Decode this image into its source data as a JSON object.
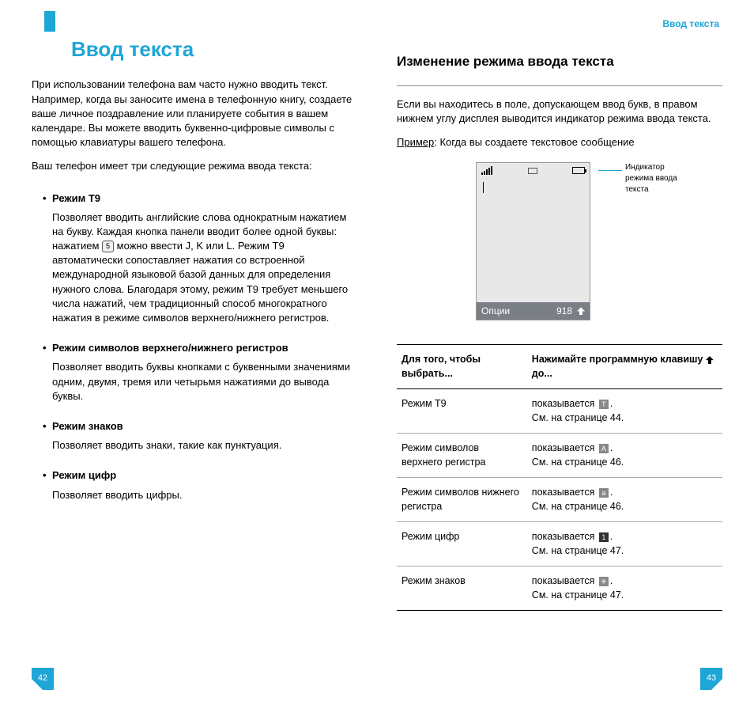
{
  "running_header": "Ввод текста",
  "left": {
    "chapter": "Ввод текста",
    "intro1": "При использовании телефона вам часто нужно вводить текст. Например, когда вы заносите имена в телефонную книгу, создаете ваше личное поздравление или планируете события в вашем календаре. Вы можете вводить буквенно-цифровые символы с помощью клавиатуры вашего телефона.",
    "intro2": "Ваш телефон имеет три следующие режима ввода текста:",
    "modes": [
      {
        "title": "Режим Т9",
        "desc_pre": "Позволяет вводить английские слова однократным нажатием на букву. Каждая кнопка панели вводит более одной буквы: нажатием ",
        "key": "5",
        "desc_post": " можно ввести J, K или L. Режим Т9 автоматически сопоставляет нажатия со встроенной международной языковой базой данных для определения нужного слова. Благодаря этому, режим T9 требует меньшего числа нажатий, чем традиционный способ многократного нажатия в режиме символов верхнего/нижнего регистров."
      },
      {
        "title": "Режим символов верхнего/нижнего регистров",
        "desc": "Позволяет вводить буквы кнопками с буквенными значениями одним, двумя, тремя или четырьмя нажатиями до вывода буквы."
      },
      {
        "title": "Режим знаков",
        "desc": "Позволяет вводить знаки, такие как пунктуация."
      },
      {
        "title": "Режим цифр",
        "desc": "Позволяет вводить цифры."
      }
    ],
    "page_num": "42"
  },
  "right": {
    "section": "Изменение режима ввода текста",
    "intro": "Если вы находитесь в поле, допускающем ввод букв, в правом нижнем углу дисплея выводится индикатор режима ввода текста.",
    "example_label": "Пример",
    "example_text": ": Когда вы создаете текстовое сообщение",
    "phone": {
      "soft_left": "Опции",
      "counter": "918"
    },
    "fig_label": "Индикатор режима ввода текста",
    "table": {
      "head1": "Для того, чтобы выбрать...",
      "head2_pre": "Нажимайте программную клавишу ",
      "head2_post": " до...",
      "rows": [
        {
          "c1": "Режим Т9",
          "show": "показывается ",
          "icon": "T",
          "ref": "См. на странице 44."
        },
        {
          "c1": "Режим символов верхнего регистра",
          "show": "показывается ",
          "icon": "A",
          "ref": "См. на странице 46."
        },
        {
          "c1": "Режим символов нижнего регистра",
          "show": "показывается ",
          "icon": "a",
          "ref": "См. на странице 46."
        },
        {
          "c1": "Режим цифр",
          "show": "показывается ",
          "icon": "1",
          "icon_dark": true,
          "ref": "См. на странице 47."
        },
        {
          "c1": "Режим знаков",
          "show": "показывается ",
          "icon": "✳",
          "ref": "См. на странице 47."
        }
      ]
    },
    "page_num": "43"
  }
}
